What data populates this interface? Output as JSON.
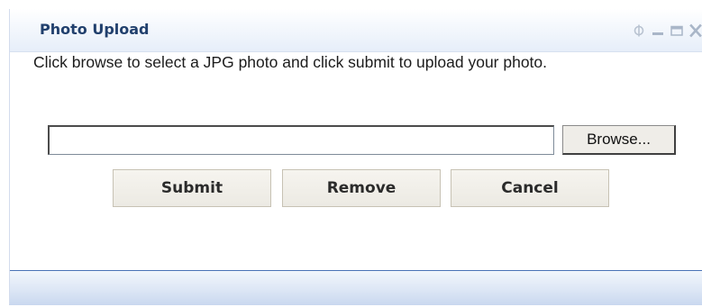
{
  "window": {
    "title": "Photo Upload",
    "controls": {
      "config_icon": "config-icon",
      "minimize_icon": "minimize-icon",
      "maximize_icon": "maximize-icon",
      "close_icon": "close-icon",
      "close_label": "X"
    }
  },
  "content": {
    "instructions": "Click browse to select a JPG photo and click submit to upload your photo.",
    "file_input": {
      "value": ""
    },
    "browse_label": "Browse...",
    "buttons": {
      "submit": "Submit",
      "remove": "Remove",
      "cancel": "Cancel"
    }
  },
  "colors": {
    "title_text": "#21406d",
    "titlebar_bg": "#e6eef9",
    "footer_border": "#4a73b6",
    "button_bg": "#efede8"
  }
}
